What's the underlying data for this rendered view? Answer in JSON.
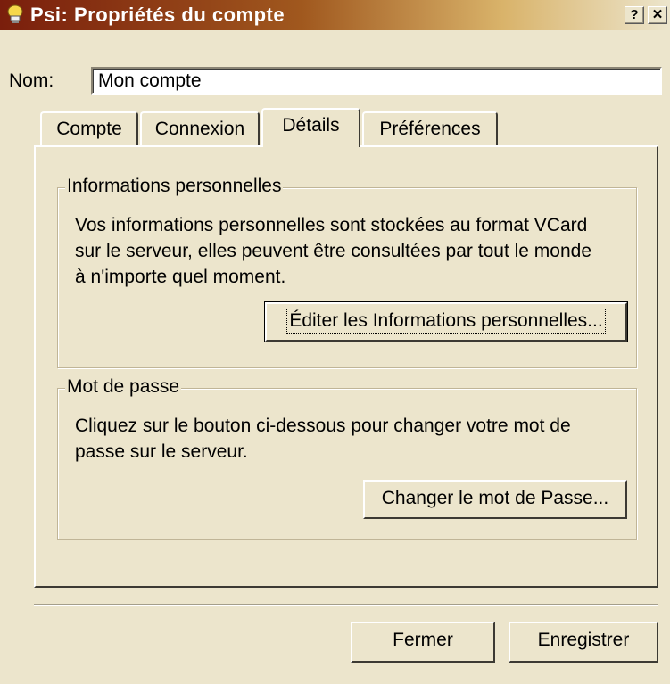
{
  "window": {
    "title": "Psi: Propriétés du compte",
    "help_button": "?",
    "close_button": "✕"
  },
  "name": {
    "label": "Nom:",
    "value": "Mon compte"
  },
  "tabs": [
    {
      "label": "Compte",
      "selected": false
    },
    {
      "label": "Connexion",
      "selected": false
    },
    {
      "label": "Détails",
      "selected": true
    },
    {
      "label": "Préférences",
      "selected": false
    }
  ],
  "personal_info": {
    "title": "Informations personnelles",
    "description": "Vos informations personnelles sont stockées au format VCard\nsur le serveur, elles peuvent être consultées par tout le monde\nà n'importe quel moment.",
    "edit_button": "Éditer les Informations personnelles..."
  },
  "password": {
    "title": "Mot de passe",
    "description": "Cliquez sur le bouton ci-dessous pour changer votre mot de\npasse sur le serveur.",
    "change_button": "Changer le mot de Passe..."
  },
  "footer": {
    "close_button": "Fermer",
    "save_button": "Enregistrer"
  },
  "icons": {
    "app": "psi-lightbulb-icon"
  },
  "colors": {
    "title_bar_start": "#7a1e0c",
    "face": "#ece5cc"
  }
}
